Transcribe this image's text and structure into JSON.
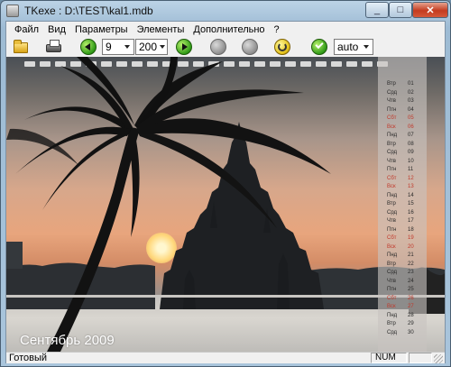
{
  "window": {
    "title": "TKexe : D:\\TEST\\kal1.mdb"
  },
  "menu": [
    "Файл",
    "Вид",
    "Параметры",
    "Элементы",
    "Дополнительно",
    "?"
  ],
  "toolbar": {
    "open_icon": "folder-open-icon",
    "print_icon": "printer-icon",
    "page_value": "9",
    "zoom_value": "200",
    "mode_value": "auto"
  },
  "image": {
    "month_label": "Сентябрь 2009"
  },
  "calendar": {
    "weekend_color": "#c0392b",
    "weekday_color": "#2a2a2a",
    "days": [
      {
        "day": "Втр",
        "num": "01"
      },
      {
        "day": "Срд",
        "num": "02"
      },
      {
        "day": "Чтв",
        "num": "03"
      },
      {
        "day": "Птн",
        "num": "04"
      },
      {
        "day": "Сбт",
        "num": "05",
        "weekend": true
      },
      {
        "day": "Вск",
        "num": "06",
        "weekend": true
      },
      {
        "day": "Пнд",
        "num": "07"
      },
      {
        "day": "Втр",
        "num": "08"
      },
      {
        "day": "Срд",
        "num": "09"
      },
      {
        "day": "Чтв",
        "num": "10"
      },
      {
        "day": "Птн",
        "num": "11"
      },
      {
        "day": "Сбт",
        "num": "12",
        "weekend": true
      },
      {
        "day": "Вск",
        "num": "13",
        "weekend": true
      },
      {
        "day": "Пнд",
        "num": "14"
      },
      {
        "day": "Втр",
        "num": "15"
      },
      {
        "day": "Срд",
        "num": "16"
      },
      {
        "day": "Чтв",
        "num": "17"
      },
      {
        "day": "Птн",
        "num": "18"
      },
      {
        "day": "Сбт",
        "num": "19",
        "weekend": true
      },
      {
        "day": "Вск",
        "num": "20",
        "weekend": true
      },
      {
        "day": "Пнд",
        "num": "21"
      },
      {
        "day": "Втр",
        "num": "22"
      },
      {
        "day": "Срд",
        "num": "23"
      },
      {
        "day": "Чтв",
        "num": "24"
      },
      {
        "day": "Птн",
        "num": "25"
      },
      {
        "day": "Сбт",
        "num": "26",
        "weekend": true
      },
      {
        "day": "Вск",
        "num": "27",
        "weekend": true
      },
      {
        "day": "Пнд",
        "num": "28"
      },
      {
        "day": "Втр",
        "num": "29"
      },
      {
        "day": "Срд",
        "num": "30"
      }
    ]
  },
  "status": {
    "text": "Готовый",
    "num": "NUM"
  }
}
